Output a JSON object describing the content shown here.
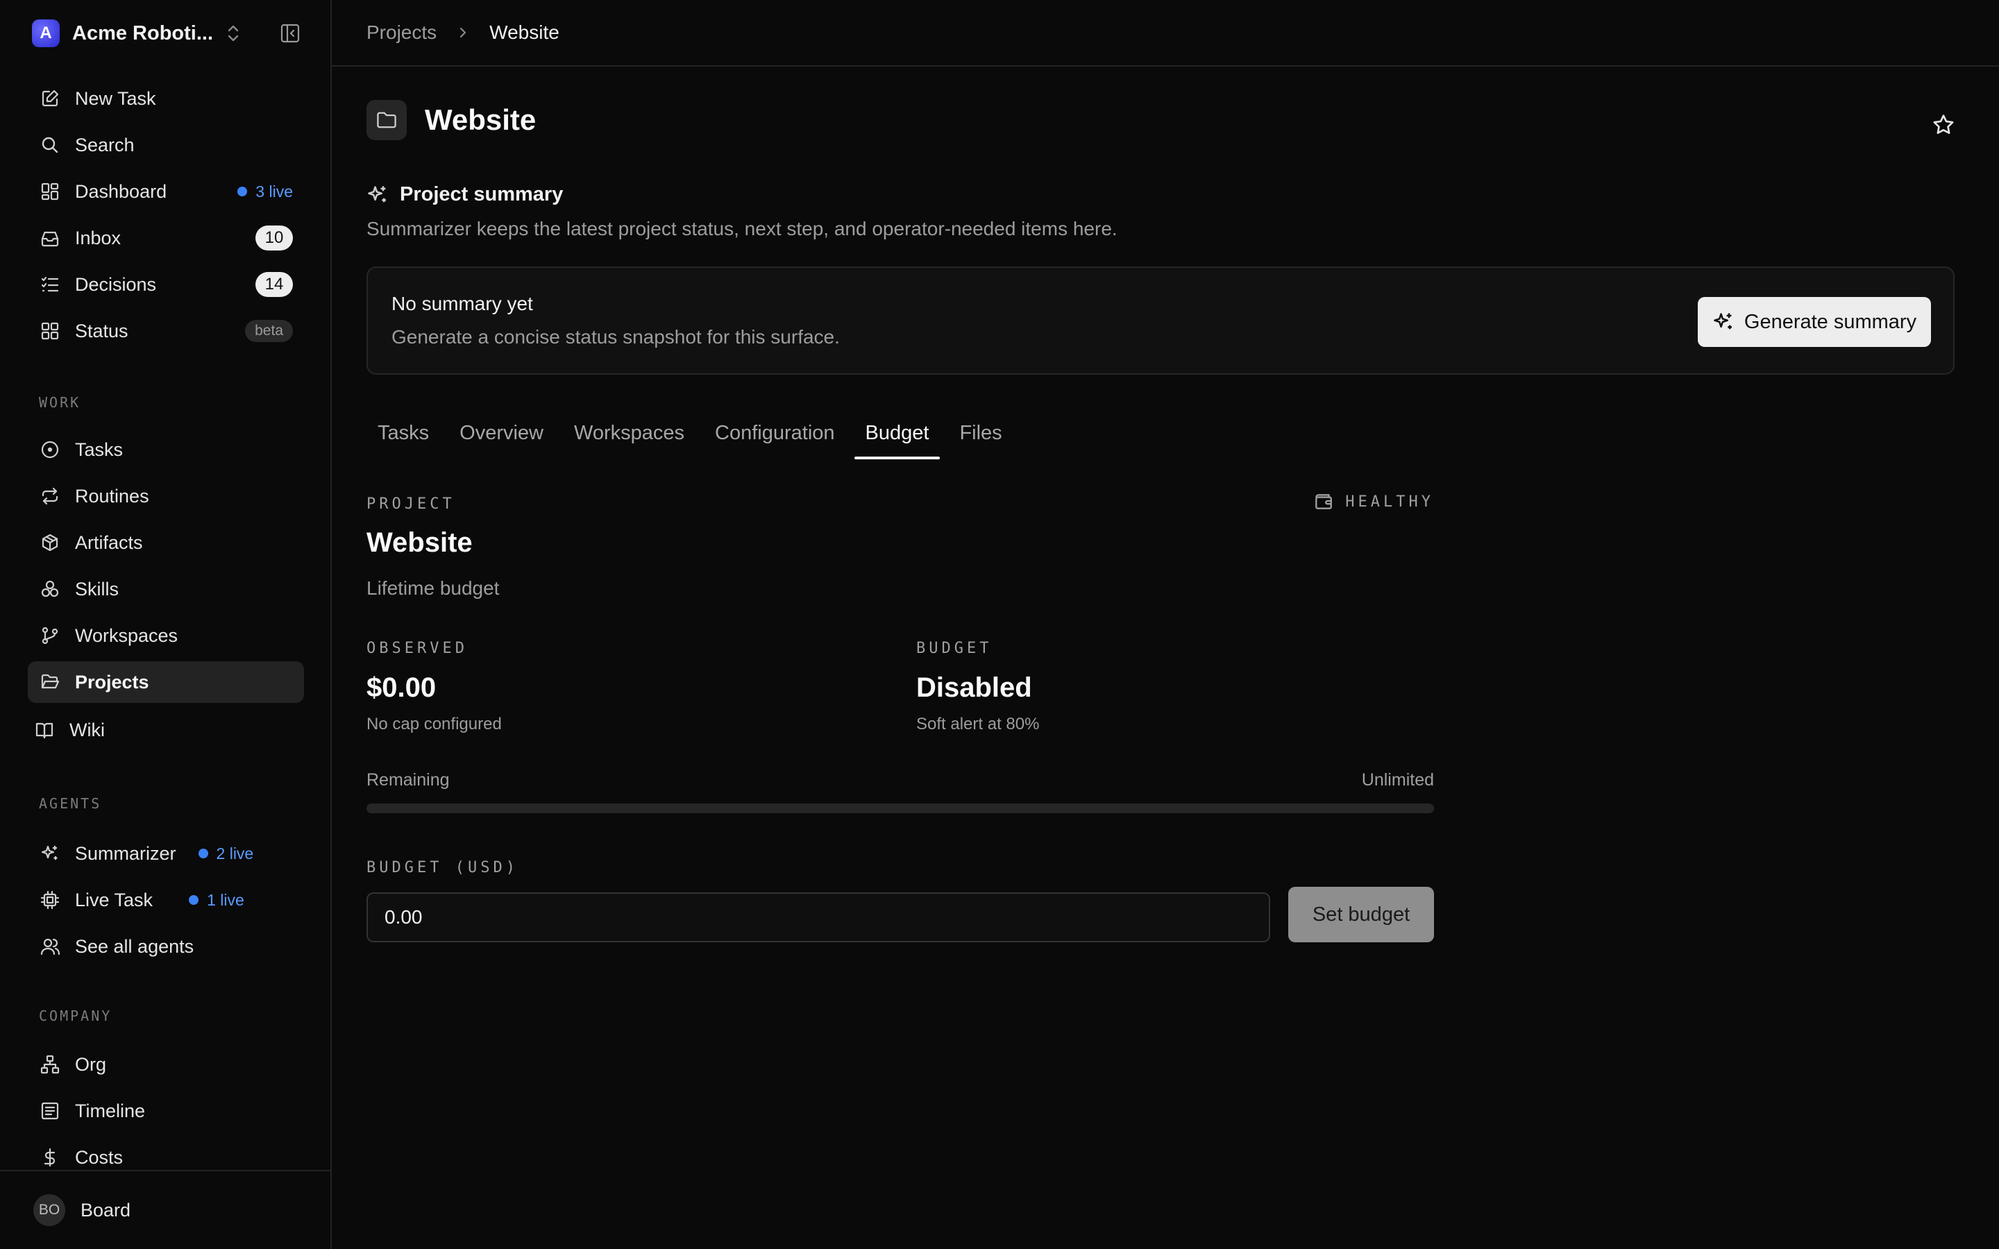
{
  "workspace": {
    "logo_letter": "A",
    "name": "Acme Roboti..."
  },
  "sidebar": {
    "top_items": [
      {
        "label": "New Task",
        "icon": "edit-icon"
      },
      {
        "label": "Search",
        "icon": "search-icon"
      },
      {
        "label": "Dashboard",
        "icon": "dashboard-icon",
        "live": "3 live"
      },
      {
        "label": "Inbox",
        "icon": "inbox-icon",
        "count": "10"
      },
      {
        "label": "Decisions",
        "icon": "checklist-icon",
        "count": "14"
      },
      {
        "label": "Status",
        "icon": "grid-icon",
        "badge": "beta"
      }
    ],
    "work_label": "WORK",
    "work_items": [
      {
        "label": "Tasks",
        "icon": "circle-dot-icon"
      },
      {
        "label": "Routines",
        "icon": "repeat-icon"
      },
      {
        "label": "Artifacts",
        "icon": "package-icon"
      },
      {
        "label": "Skills",
        "icon": "circles-icon"
      },
      {
        "label": "Workspaces",
        "icon": "branch-icon"
      },
      {
        "label": "Projects",
        "icon": "folder-open-icon",
        "active": true
      },
      {
        "label": "Wiki",
        "icon": "book-icon"
      }
    ],
    "agents_label": "AGENTS",
    "agent_items": [
      {
        "label": "Summarizer",
        "icon": "sparkles-icon",
        "live": "2 live"
      },
      {
        "label": "Live Task",
        "icon": "cpu-icon",
        "live": "1 live"
      },
      {
        "label": "See all agents",
        "icon": "users-icon"
      }
    ],
    "company_label": "COMPANY",
    "company_items": [
      {
        "label": "Org",
        "icon": "org-icon"
      },
      {
        "label": "Timeline",
        "icon": "timeline-icon"
      },
      {
        "label": "Costs",
        "icon": "dollar-icon"
      }
    ],
    "footer": {
      "initials": "BO",
      "name": "Board"
    }
  },
  "breadcrumb": {
    "parent": "Projects",
    "current": "Website"
  },
  "page": {
    "title": "Website"
  },
  "summary": {
    "title": "Project summary",
    "description": "Summarizer keeps the latest project status, next step, and operator-needed items here.",
    "card_title": "No summary yet",
    "card_description": "Generate a concise status snapshot for this surface.",
    "button_label": "Generate summary"
  },
  "tabs": [
    {
      "label": "Tasks"
    },
    {
      "label": "Overview"
    },
    {
      "label": "Workspaces"
    },
    {
      "label": "Configuration"
    },
    {
      "label": "Budget",
      "active": true
    },
    {
      "label": "Files"
    }
  ],
  "budget": {
    "project_label": "PROJECT",
    "health_label": "HEALTHY",
    "project_name": "Website",
    "subtitle": "Lifetime budget",
    "observed_label": "OBSERVED",
    "observed_value": "$0.00",
    "observed_note": "No cap configured",
    "budget_label": "BUDGET",
    "budget_value": "Disabled",
    "budget_note": "Soft alert at 80%",
    "remaining_label": "Remaining",
    "remaining_value": "Unlimited",
    "remaining_fraction": 0,
    "input_label": "BUDGET (USD)",
    "input_value": "0.00",
    "set_button": "Set budget"
  },
  "colors": {
    "accent": "#3b82f6",
    "background": "#0a0a0a"
  }
}
